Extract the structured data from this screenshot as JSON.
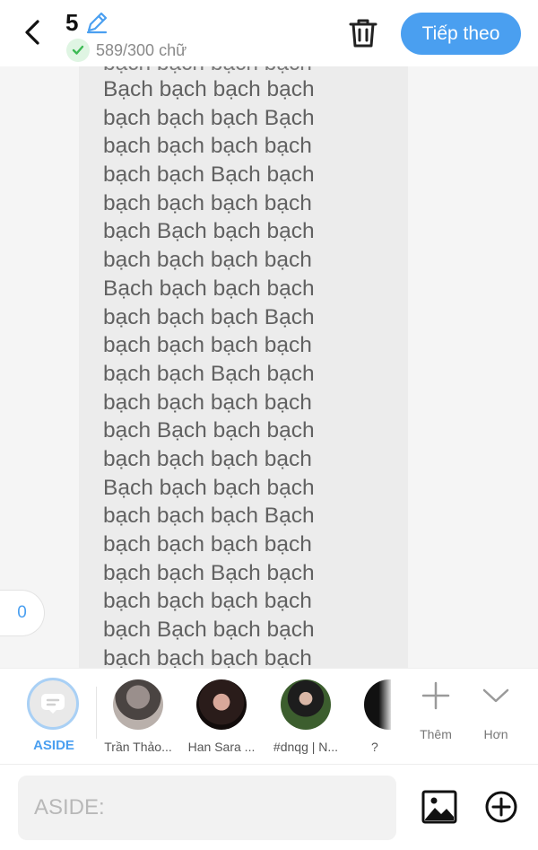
{
  "header": {
    "title_number": "5",
    "word_count": "589/300 chữ",
    "next_label": "Tiếp theo"
  },
  "content": {
    "cut_line": "bạch bạch bạch bạch",
    "lines": [
      "Bạch bạch bạch bạch",
      "bạch bạch bạch Bạch",
      "bạch bạch bạch bạch",
      "bạch bạch Bạch bạch",
      "bạch bạch bạch bạch",
      "bạch Bạch bạch bạch",
      "bạch bạch bạch bạch",
      "Bạch bạch bạch bạch",
      "bạch bạch bạch Bạch",
      "bạch bạch bạch bạch",
      "bạch bạch Bạch bạch",
      "bạch bạch bạch bạch",
      "bạch Bạch bạch bạch",
      "bạch bạch bạch bạch",
      "Bạch bạch bạch bạch",
      "bạch bạch bạch Bạch",
      "bạch bạch bạch bạch",
      "bạch bạch Bạch bạch",
      "bạch bạch bạch bạch",
      "bạch Bạch bạch bạch",
      "bạch bạch bạch bạch"
    ],
    "counter": "0"
  },
  "tags": {
    "aside_label": "ASIDE",
    "profiles": [
      {
        "label": "Trần Thảo..."
      },
      {
        "label": "Han Sara ..."
      },
      {
        "label": "#dnqg | N..."
      },
      {
        "label": "?"
      }
    ],
    "more_label": "Thêm",
    "expand_label": "Hơn"
  },
  "composer": {
    "placeholder": "ASIDE:"
  },
  "colors": {
    "accent": "#4a9ff0",
    "check_green": "#3cba54"
  }
}
